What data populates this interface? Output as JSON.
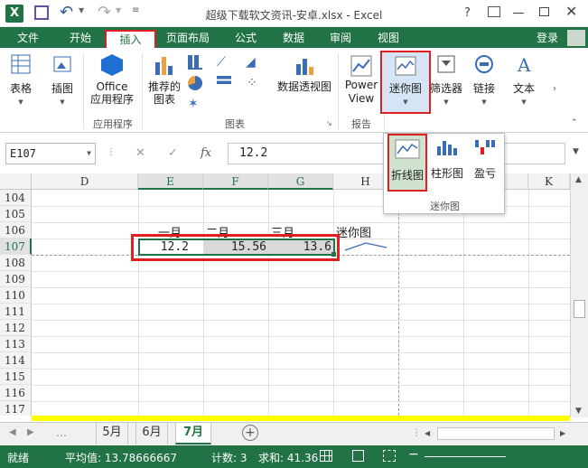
{
  "window": {
    "title": "超级下载软文资讯-安卓.xlsx - Excel",
    "help": "?",
    "login": "登录"
  },
  "tabs": [
    "文件",
    "开始",
    "插入",
    "页面布局",
    "公式",
    "数据",
    "审阅",
    "视图"
  ],
  "ribbon": {
    "table": "表格",
    "illustrations": "插图",
    "office_apps": "Office\n应用程序",
    "recommended_charts": "推荐的\n图表",
    "pivot_chart": "数据透视图",
    "power_view": "Power\nView",
    "sparklines": "迷你图",
    "slicers": "筛选器",
    "links": "链接",
    "text": "文本",
    "group_apps": "应用程序",
    "group_charts": "图表",
    "group_reports": "报告"
  },
  "flyout": {
    "line": "折线图",
    "column": "柱形图",
    "winloss": "盈亏",
    "group": "迷你图"
  },
  "formula_bar": {
    "name_box": "E107",
    "formula": "12.2",
    "fx": "fx"
  },
  "columns": [
    "D",
    "E",
    "F",
    "G",
    "H",
    "I",
    "J",
    "K"
  ],
  "rows": [
    "104",
    "105",
    "106",
    "107",
    "108",
    "109",
    "110",
    "111",
    "112",
    "113",
    "114",
    "115",
    "116",
    "117"
  ],
  "cells": {
    "E106": "一月",
    "F106": "二月",
    "G106": "三月",
    "H106": "迷你图",
    "E107": "12.2",
    "F107": "15.56",
    "G107": "13.6"
  },
  "sheets": [
    "5月",
    "6月",
    "7月"
  ],
  "status": {
    "ready": "就绪",
    "average": "平均值: 13.78666667",
    "count": "计数: 3",
    "sum": "求和: 41.36"
  },
  "colors": {
    "excel_green": "#217346",
    "highlight_red": "#e02020",
    "selection_gray": "#d9d9d9",
    "yellow_bar": "#ffff00"
  }
}
